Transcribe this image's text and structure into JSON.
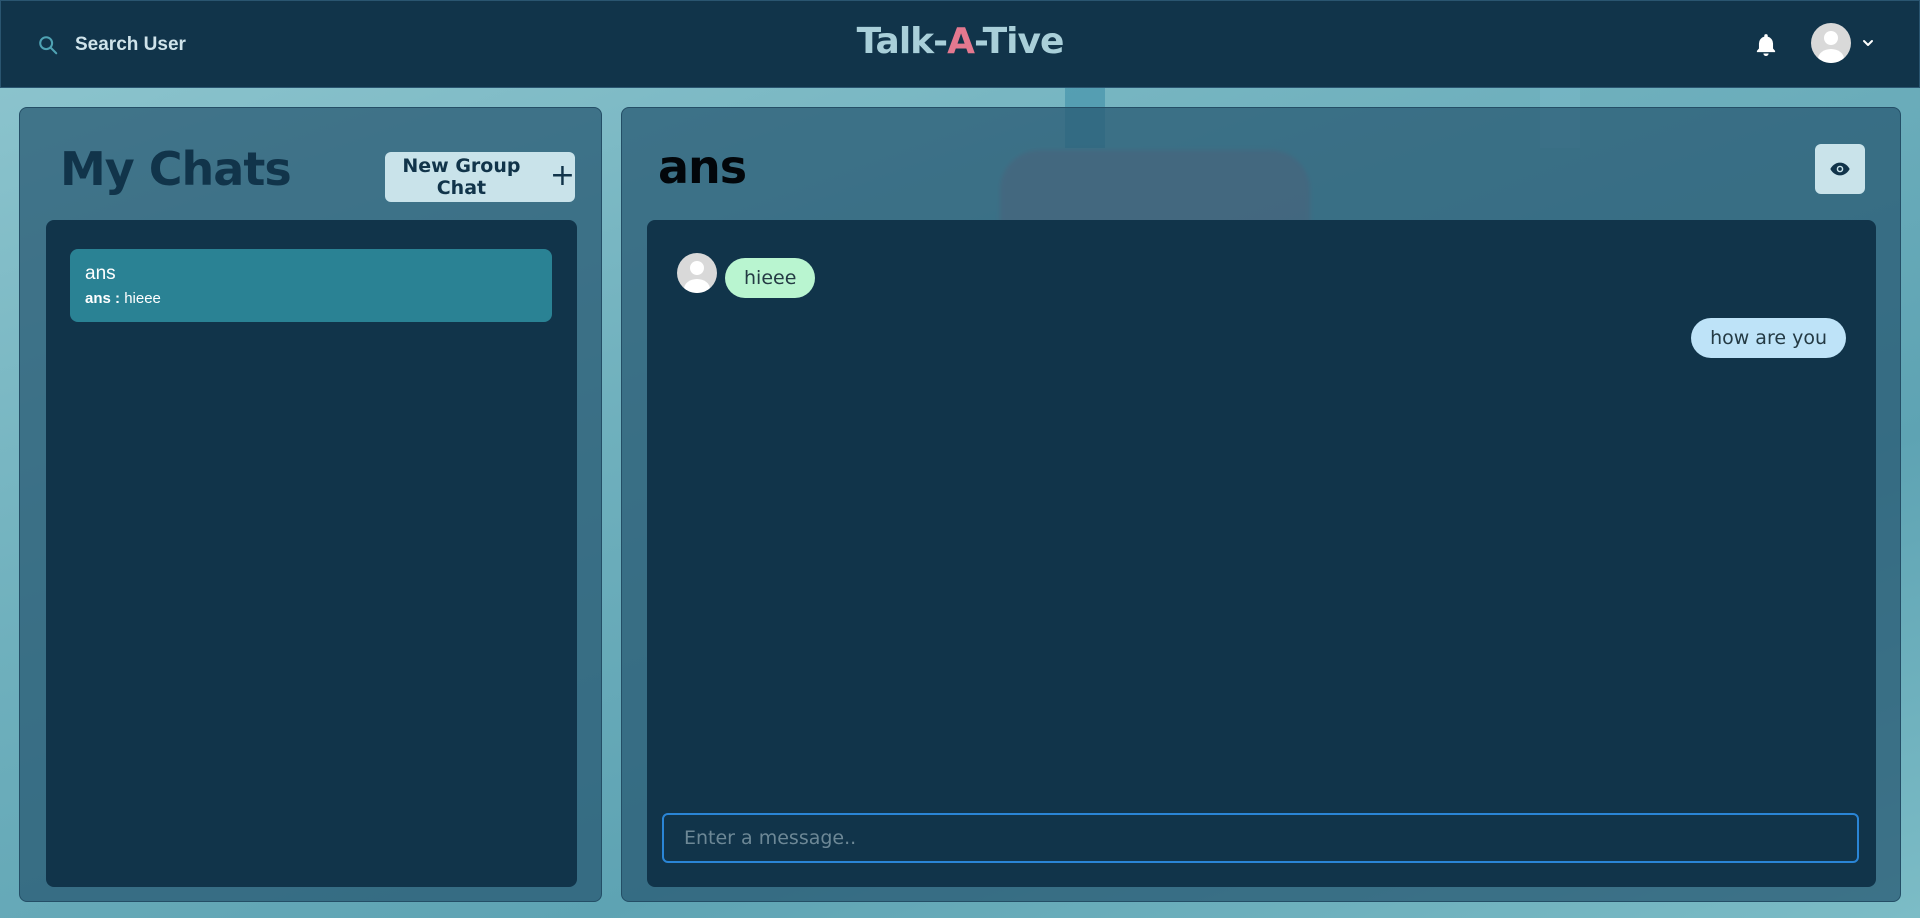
{
  "header": {
    "search_label": "Search User",
    "logo_prefix": "Talk-",
    "logo_accent": "A",
    "logo_suffix": "-Tive"
  },
  "chats_panel": {
    "title": "My Chats",
    "new_group_label": "New Group Chat",
    "items": [
      {
        "name": "ans",
        "preview_sender": "ans :",
        "preview_text": "hieee",
        "selected": true
      }
    ]
  },
  "conversation": {
    "title": "ans",
    "messages": [
      {
        "text": "hieee",
        "direction": "received"
      },
      {
        "text": "how are you",
        "direction": "sent"
      }
    ],
    "composer_placeholder": "Enter a message.."
  },
  "colors": {
    "header_bg": "#11344a",
    "accent_pink": "#e4788f",
    "selected_chat": "#2a8294",
    "received_bubble": "#b9f5d0",
    "sent_bubble": "#bee3f8",
    "composer_focus": "#2a85d6"
  },
  "icons": {
    "search": "search-icon",
    "bell": "bell-icon",
    "avatar": "avatar-icon",
    "chevron": "chevron-down-icon",
    "plus": "plus-icon",
    "eye": "eye-icon"
  }
}
